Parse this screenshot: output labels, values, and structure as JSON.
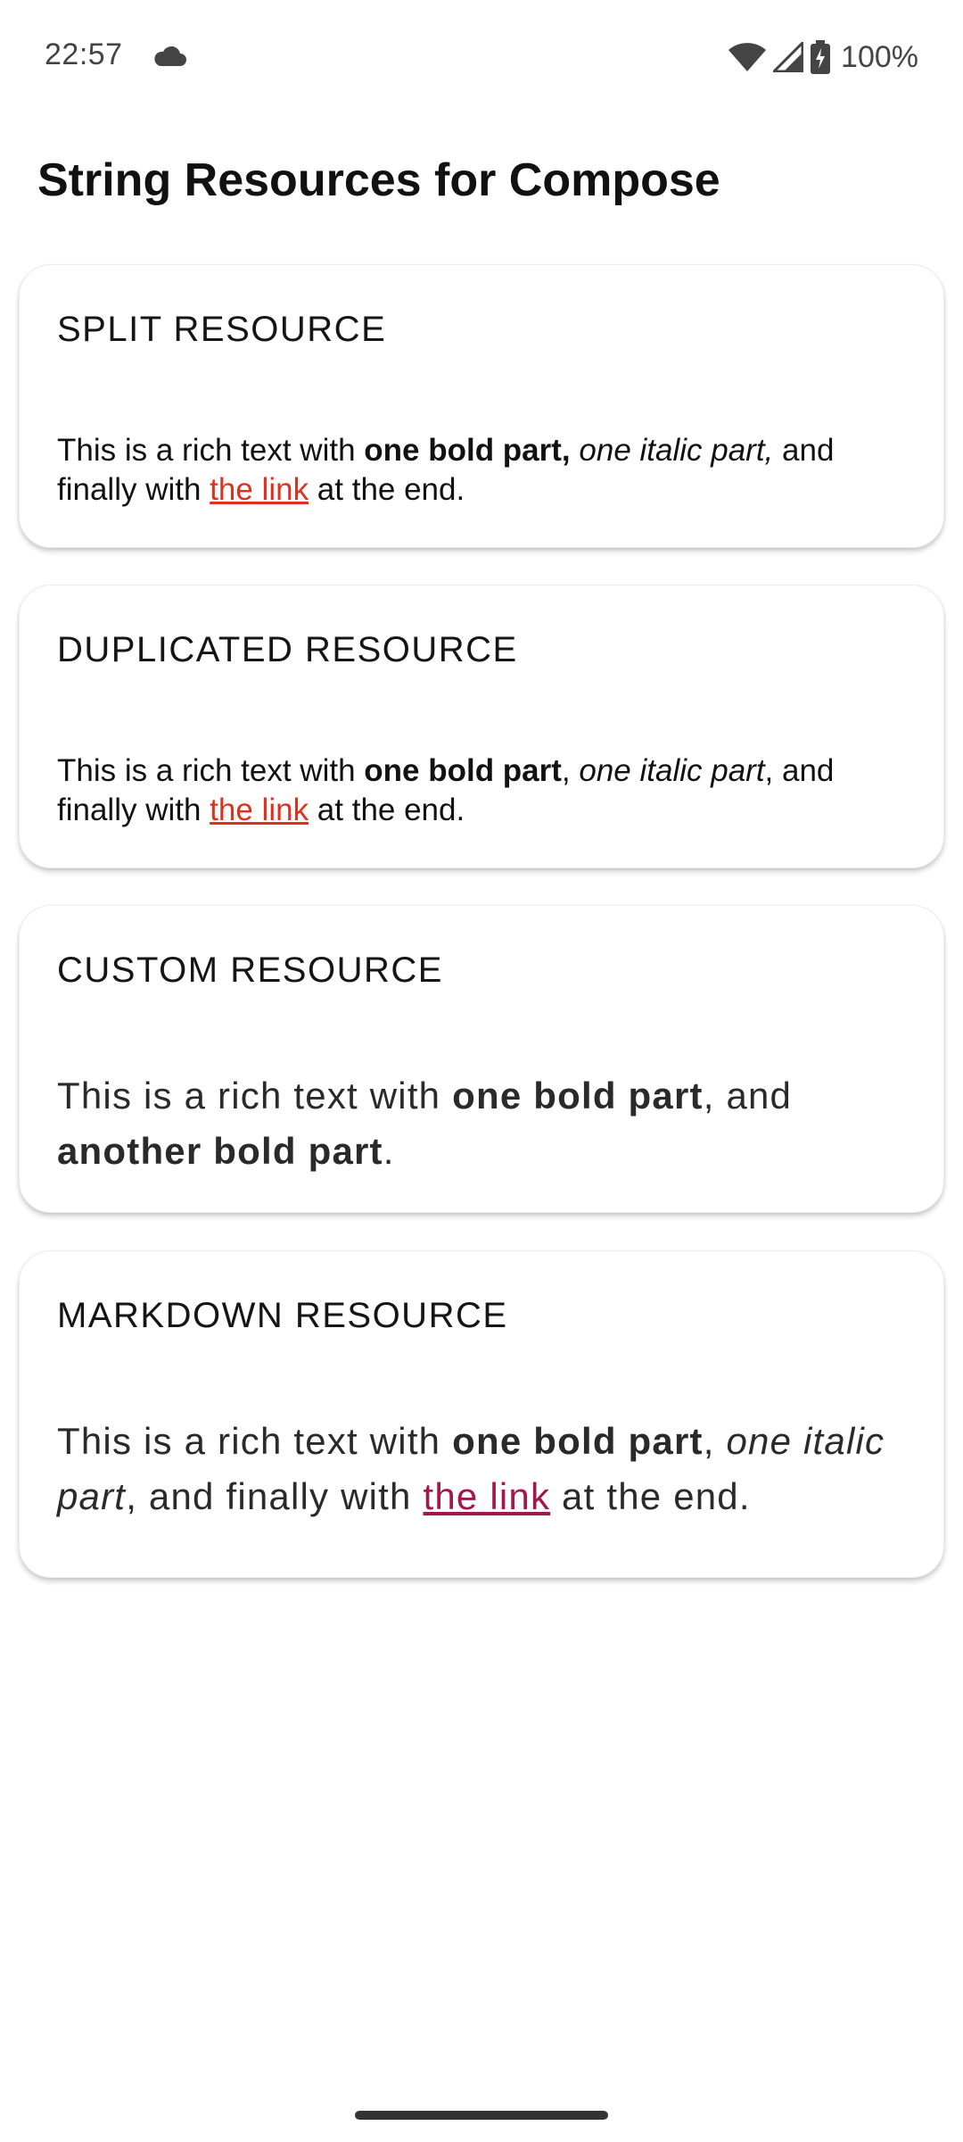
{
  "status_bar": {
    "time": "22:57",
    "battery": "100%",
    "icons": [
      "cloud-icon",
      "wifi-icon",
      "signal-icon",
      "battery-charging-icon"
    ]
  },
  "title": "String Resources for Compose",
  "colors": {
    "link_red": "#e0301e",
    "link_maroon": "#a3174a"
  },
  "cards": [
    {
      "title": "SPLIT RESOURCE",
      "parts": {
        "p1": "This is a rich text with ",
        "bold": "one bold part,",
        "p2": " ",
        "italic": "one italic part,",
        "p3": " and finally with ",
        "link": "the link",
        "p4": " at the end."
      }
    },
    {
      "title": "DUPLICATED RESOURCE",
      "parts": {
        "p1": "This is a rich text with ",
        "bold": "one bold part",
        "p2": ", ",
        "italic": "one italic part",
        "p3": ", and finally with ",
        "link": "the link",
        "p4": " at the end."
      }
    },
    {
      "title": "CUSTOM RESOURCE",
      "parts": {
        "p1": "This is a rich text with ",
        "bold1": "one bold part",
        "p2": ", and ",
        "bold2": "another bold part",
        "p3": "."
      }
    },
    {
      "title": "MARKDOWN RESOURCE",
      "parts": {
        "p1": "This is a rich text with ",
        "bold": "one bold part",
        "p2": ", ",
        "italic": "one italic part",
        "p3": ", and finally with ",
        "link": "the link",
        "p4": " at the end."
      }
    }
  ]
}
